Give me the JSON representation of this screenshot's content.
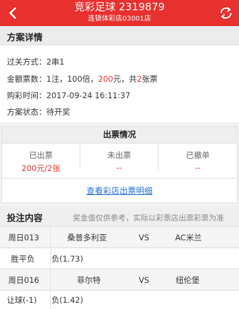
{
  "header": {
    "title": "竞彩足球  2319879",
    "subtitle": "连锁体彩店03001店"
  },
  "plan": {
    "section_title": "方案详情",
    "pass_label": "过关方式：",
    "pass_value": "2串1",
    "amount_label": "金额票数：",
    "amount_prefix": "1注，100倍，",
    "amount_money": "200",
    "amount_mid": "元，共",
    "amount_tickets": "2",
    "amount_suffix": "张票",
    "time_label": "购彩时间：",
    "time_value": "2017-09-24 16:11:37",
    "status_label": "方案状态：",
    "status_value": "待开奖"
  },
  "tickets": {
    "title": "出票情况",
    "cols": [
      {
        "label": "已出票",
        "value": "200元/2张"
      },
      {
        "label": "未出票",
        "value": "--"
      },
      {
        "label": "已撤单",
        "value": "--"
      }
    ],
    "link": "查看彩店出票明细"
  },
  "bets": {
    "title": "投注内容",
    "note": "奖金值仅供参考，实际以彩票店出票彩票为准",
    "matches": [
      {
        "id": "周日013",
        "home": "桑普多利亚",
        "vs": "VS",
        "away": "AC米兰",
        "play": "胜平负",
        "pick": "负(1.73)"
      },
      {
        "id": "周日016",
        "home": "菲尔特",
        "vs": "VS",
        "away": "纽伦堡",
        "play": "让球(-1)",
        "pick": "负(1.42)"
      }
    ]
  },
  "colors": {
    "accent": "#e8302f",
    "link": "#2a6fd1"
  }
}
